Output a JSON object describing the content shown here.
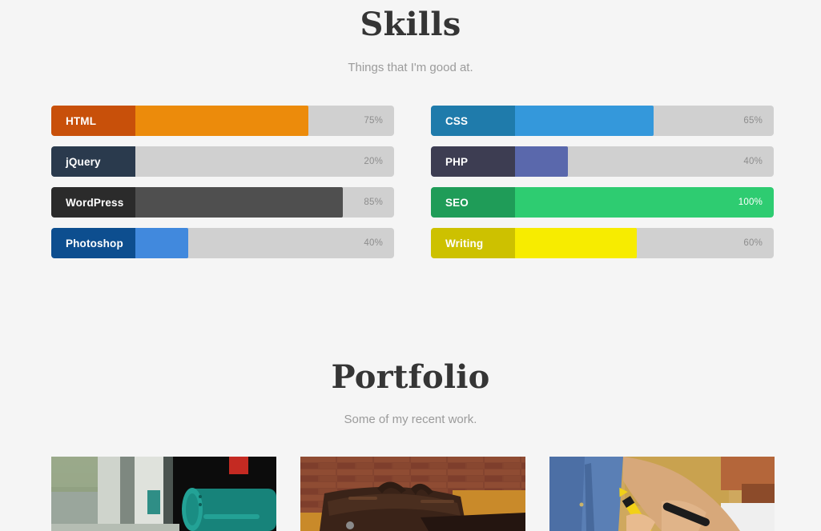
{
  "skills": {
    "title": "Skills",
    "subtitle": "Things that I'm good at.",
    "items": [
      {
        "label": "HTML",
        "percent": 75,
        "percent_text": "75%",
        "fill": "#ec8b0b",
        "label_bg": "#c8500a",
        "column": "left"
      },
      {
        "label": "CSS",
        "percent": 65,
        "percent_text": "65%",
        "fill": "#3498db",
        "label_bg": "#1f7bab",
        "column": "right"
      },
      {
        "label": "jQuery",
        "percent": 20,
        "percent_text": "20%",
        "fill": "#34495e",
        "label_bg": "#2a3a4d",
        "column": "left"
      },
      {
        "label": "PHP",
        "percent": 40,
        "percent_text": "40%",
        "fill": "#5a68ac",
        "label_bg": "#3d3d52",
        "column": "right"
      },
      {
        "label": "WordPress",
        "percent": 85,
        "percent_text": "85%",
        "fill": "#4f4f4f",
        "label_bg": "#2b2b2b",
        "column": "left"
      },
      {
        "label": "SEO",
        "percent": 100,
        "percent_text": "100%",
        "fill": "#2ecc71",
        "label_bg": "#1f9c58",
        "column": "right"
      },
      {
        "label": "Photoshop",
        "percent": 40,
        "percent_text": "40%",
        "fill": "#4189dd",
        "label_bg": "#0d4e8f",
        "column": "left"
      },
      {
        "label": "Writing",
        "percent": 60,
        "percent_text": "60%",
        "fill": "#f7ec00",
        "label_bg": "#cdc100",
        "column": "right"
      }
    ],
    "track_color": "#d0d0d0"
  },
  "portfolio": {
    "title": "Portfolio",
    "subtitle": "Some of my recent work.",
    "items": [
      {
        "name": "mailbox-photo",
        "alt": "Teal mailbox on a street"
      },
      {
        "name": "leather-bag-photo",
        "alt": "Leather bag against a brick wall"
      },
      {
        "name": "writing-photo",
        "alt": "Person in blue shirt writing with a yellow pen"
      }
    ]
  },
  "theme": {
    "background": "#f5f5f5",
    "heading_color": "#353535",
    "subtitle_color": "#9b9b9b"
  }
}
